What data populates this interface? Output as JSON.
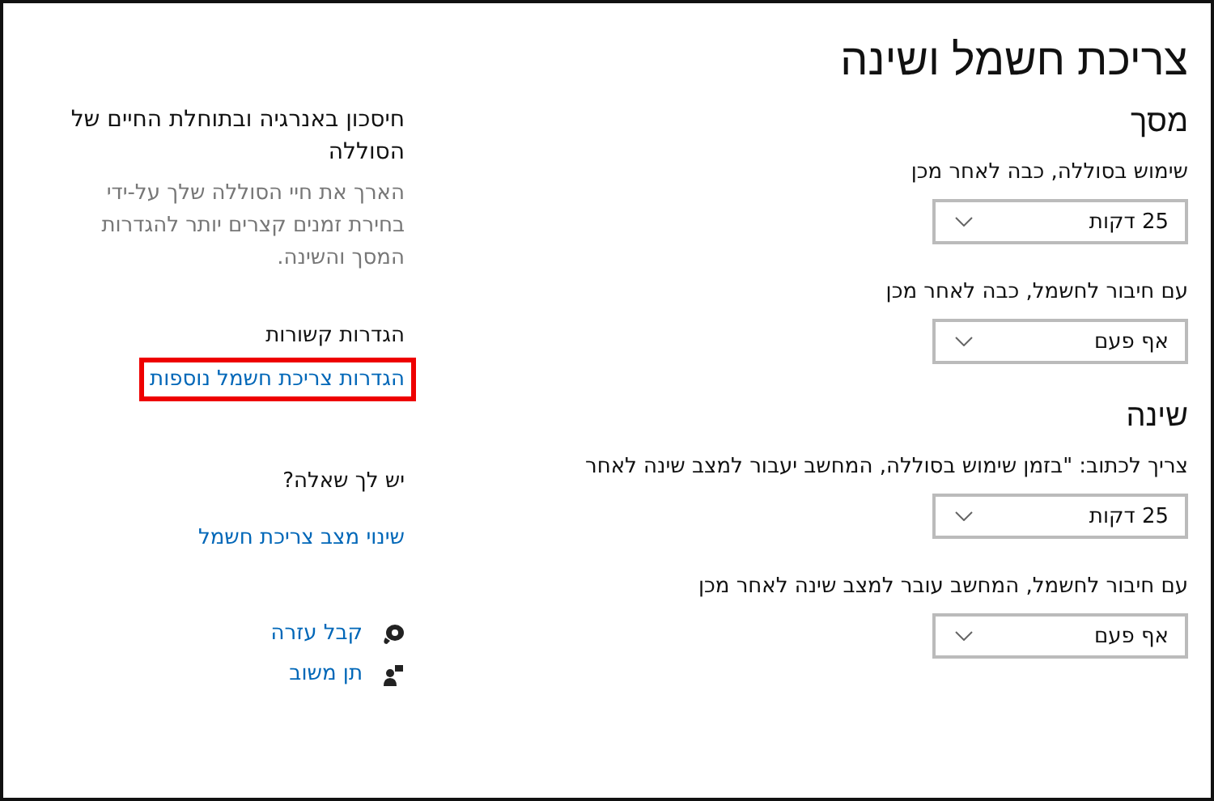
{
  "title": "צריכת חשמל ושינה",
  "sections": [
    {
      "heading": "מסך",
      "settings": [
        {
          "label": "שימוש בסוללה, כבה לאחר מכן",
          "value": "25 דקות"
        },
        {
          "label": "עם חיבור לחשמל, כבה לאחר מכן",
          "value": "אף פעם"
        }
      ]
    },
    {
      "heading": "שינה",
      "settings": [
        {
          "label": "צריך לכתוב: \"בזמן שימוש בסוללה, המחשב יעבור למצב שינה לאחר",
          "value": "25 דקות"
        },
        {
          "label": "עם חיבור לחשמל, המחשב עובר למצב שינה לאחר מכן",
          "value": "אף פעם"
        }
      ]
    }
  ],
  "side": {
    "tip": {
      "heading": "חיסכון באנרגיה ובתוחלת החיים של הסוללה",
      "text": "הארך את חיי הסוללה שלך על-ידי בחירת זמנים קצרים יותר להגדרות המסך והשינה."
    },
    "related": {
      "heading": "הגדרות קשורות",
      "links": [
        {
          "label": "הגדרות צריכת חשמל נוספות",
          "highlighted": true
        }
      ]
    },
    "question": {
      "heading": "יש לך שאלה?",
      "links": [
        {
          "label": "שינוי מצב צריכת חשמל",
          "highlighted": false
        }
      ]
    },
    "help": [
      {
        "kind": "help",
        "label": "קבל עזרה"
      },
      {
        "kind": "feedback",
        "label": "תן משוב"
      }
    ]
  }
}
